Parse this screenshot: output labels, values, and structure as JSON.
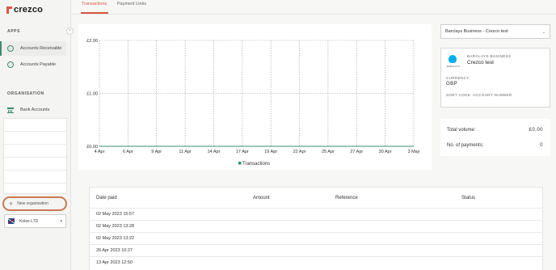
{
  "brand": {
    "name": "crezco",
    "accent": "#d6583e",
    "green": "#3c8c6c"
  },
  "sidebar": {
    "apps_label": "APPS",
    "apps": [
      {
        "label": "Accounts Receivable",
        "icon": "arrow-in-icon",
        "active": true
      },
      {
        "label": "Accounts Payable",
        "icon": "arrow-out-icon",
        "active": false
      }
    ],
    "org_label": "ORGANISATION",
    "org_items": [
      {
        "label": "Bank Accounts",
        "icon": "bank-icon"
      }
    ],
    "new_org_label": "New organisation",
    "org_select_value": "Kotze LTD"
  },
  "tabs": [
    {
      "label": "Transactions",
      "active": true
    },
    {
      "label": "Payment Links",
      "active": false
    }
  ],
  "chart_data": {
    "type": "line",
    "x": [
      "4 Apr",
      "6 Apr",
      "9 Apr",
      "11 Apr",
      "14 Apr",
      "17 Apr",
      "19 Apr",
      "22 Apr",
      "25 Apr",
      "27 Apr",
      "30 Apr",
      "3 May"
    ],
    "y_ticks": [
      "£2.00",
      "£1.00",
      "£0.00"
    ],
    "ylim": [
      0,
      2
    ],
    "series": [
      {
        "name": "Transactions",
        "color": "#3c8c6c",
        "values": [
          0,
          0,
          0,
          0,
          0,
          0,
          0,
          0,
          0,
          0,
          0,
          0
        ]
      }
    ],
    "grid": true,
    "legend": "bottom"
  },
  "account": {
    "select_value": "Barclays Business - Crezco test",
    "bank_logo_text": "BARCLAYS",
    "bank_name": "BARCLAYS BUSINESS",
    "account_name": "Crezco test",
    "currency_label": "CURRENCY",
    "currency": "GBP",
    "sort_code_label": "SORT CODE",
    "account_number_label": "ACCOUNT NUMBER"
  },
  "stats": {
    "total_volume_label": "Total volume:",
    "total_volume": "£0.00",
    "payments_label": "No. of payments:",
    "payments": "0"
  },
  "table": {
    "headers": [
      "Date paid",
      "Amount",
      "Reference",
      "Status"
    ],
    "rows": [
      {
        "date": "02 May 2023 15:57"
      },
      {
        "date": "02 May 2023 13:28"
      },
      {
        "date": "02 May 2023 13:22"
      },
      {
        "date": "26 Apr 2023 10:27"
      },
      {
        "date": "13 Apr 2023 12:50"
      }
    ]
  }
}
